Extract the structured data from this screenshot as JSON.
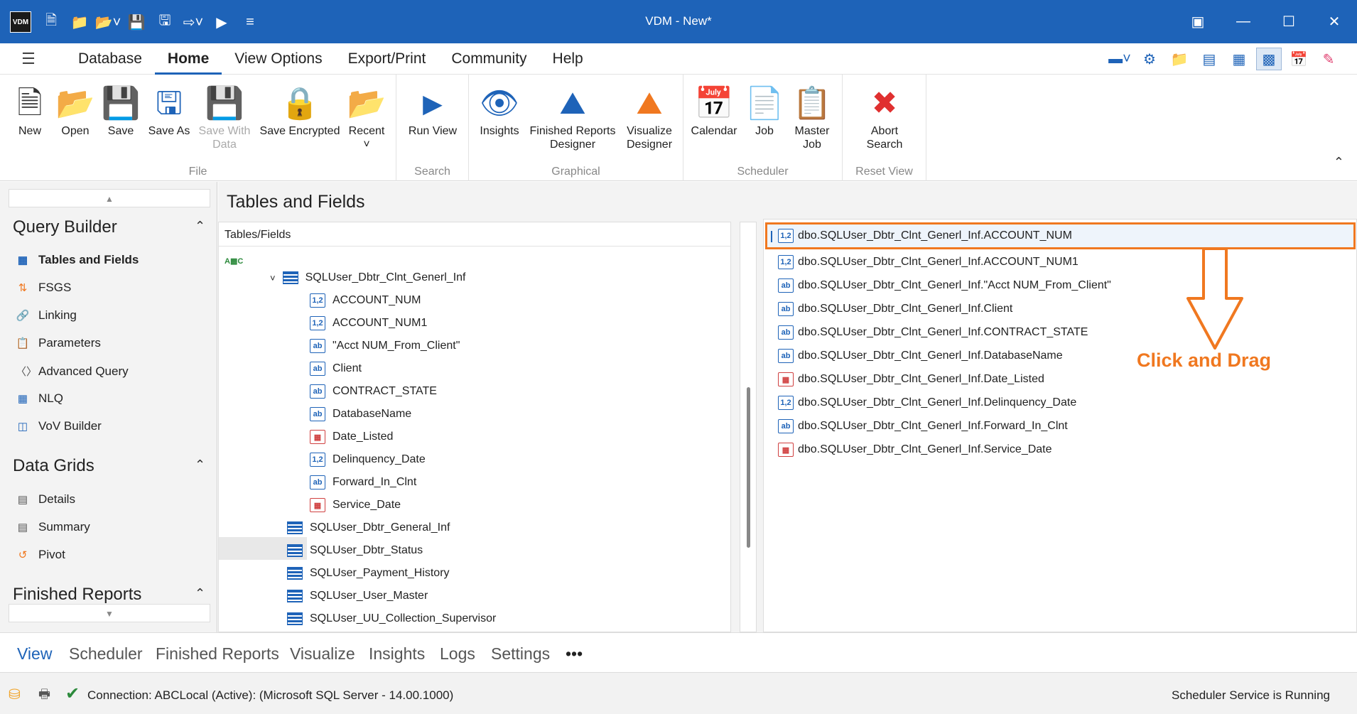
{
  "window": {
    "title": "VDM - New*",
    "logo": "VDM"
  },
  "menu": {
    "tabs": [
      "Database",
      "Home",
      "View Options",
      "Export/Print",
      "Community",
      "Help"
    ],
    "active": "Home"
  },
  "ribbon": {
    "file": {
      "label": "File",
      "buttons": {
        "new": "New",
        "open": "Open",
        "save": "Save",
        "save_as": "Save As",
        "save_with_data": "Save With Data",
        "save_encrypted": "Save Encrypted",
        "recent": "Recent"
      }
    },
    "search": {
      "label": "Search",
      "buttons": {
        "run_view": "Run View"
      }
    },
    "graphical": {
      "label": "Graphical",
      "buttons": {
        "insights": "Insights",
        "finished_reports_designer": "Finished Reports Designer",
        "visualize_designer": "Visualize Designer"
      }
    },
    "scheduler": {
      "label": "Scheduler",
      "buttons": {
        "calendar": "Calendar",
        "job": "Job",
        "master_job": "Master Job"
      }
    },
    "reset_view": {
      "label": "Reset View",
      "buttons": {
        "abort_search": "Abort Search"
      }
    }
  },
  "left": {
    "query_builder": {
      "title": "Query Builder",
      "items": [
        "Tables and Fields",
        "FSGS",
        "Linking",
        "Parameters",
        "Advanced Query",
        "NLQ",
        "VoV Builder"
      ]
    },
    "data_grids": {
      "title": "Data Grids",
      "items": [
        "Details",
        "Summary",
        "Pivot"
      ]
    },
    "finished_reports": {
      "title": "Finished Reports"
    }
  },
  "main": {
    "title": "Tables and Fields",
    "tree": {
      "header": "Tables/Fields",
      "table": "SQLUser_Dbtr_Clnt_Generl_Inf",
      "fields": [
        {
          "name": "ACCOUNT_NUM",
          "type": "1,2"
        },
        {
          "name": "ACCOUNT_NUM1",
          "type": "1,2"
        },
        {
          "name": "\"Acct NUM_From_Client\"",
          "type": "ab"
        },
        {
          "name": "Client",
          "type": "ab"
        },
        {
          "name": "CONTRACT_STATE",
          "type": "ab"
        },
        {
          "name": "DatabaseName",
          "type": "ab"
        },
        {
          "name": "Date_Listed",
          "type": "date"
        },
        {
          "name": "Delinquency_Date",
          "type": "1,2"
        },
        {
          "name": "Forward_In_Clnt",
          "type": "ab"
        },
        {
          "name": "Service_Date",
          "type": "date"
        }
      ],
      "other_tables": [
        "SQLUser_Dbtr_General_Inf",
        "SQLUser_Dbtr_Status",
        "SQLUser_Payment_History",
        "SQLUser_User_Master",
        "SQLUser_UU_Collection_Supervisor"
      ]
    },
    "selected": [
      {
        "name": "dbo.SQLUser_Dbtr_Clnt_Generl_Inf.ACCOUNT_NUM",
        "type": "1,2"
      },
      {
        "name": "dbo.SQLUser_Dbtr_Clnt_Generl_Inf.ACCOUNT_NUM1",
        "type": "1,2"
      },
      {
        "name": "dbo.SQLUser_Dbtr_Clnt_Generl_Inf.\"Acct NUM_From_Client\"",
        "type": "ab"
      },
      {
        "name": "dbo.SQLUser_Dbtr_Clnt_Generl_Inf.Client",
        "type": "ab"
      },
      {
        "name": "dbo.SQLUser_Dbtr_Clnt_Generl_Inf.CONTRACT_STATE",
        "type": "ab"
      },
      {
        "name": "dbo.SQLUser_Dbtr_Clnt_Generl_Inf.DatabaseName",
        "type": "ab"
      },
      {
        "name": "dbo.SQLUser_Dbtr_Clnt_Generl_Inf.Date_Listed",
        "type": "date"
      },
      {
        "name": "dbo.SQLUser_Dbtr_Clnt_Generl_Inf.Delinquency_Date",
        "type": "1,2"
      },
      {
        "name": "dbo.SQLUser_Dbtr_Clnt_Generl_Inf.Forward_In_Clnt",
        "type": "ab"
      },
      {
        "name": "dbo.SQLUser_Dbtr_Clnt_Generl_Inf.Service_Date",
        "type": "date"
      }
    ],
    "annotation": "Click and Drag"
  },
  "bottom_tabs": [
    "View",
    "Scheduler",
    "Finished Reports",
    "Visualize",
    "Insights",
    "Logs",
    "Settings",
    "•••"
  ],
  "status": {
    "connection": "Connection: ABCLocal (Active): (Microsoft SQL Server - 14.00.1000)",
    "scheduler": "Scheduler Service is Running"
  },
  "colors": {
    "accent": "#1e63b8",
    "annotation": "#f07820"
  }
}
